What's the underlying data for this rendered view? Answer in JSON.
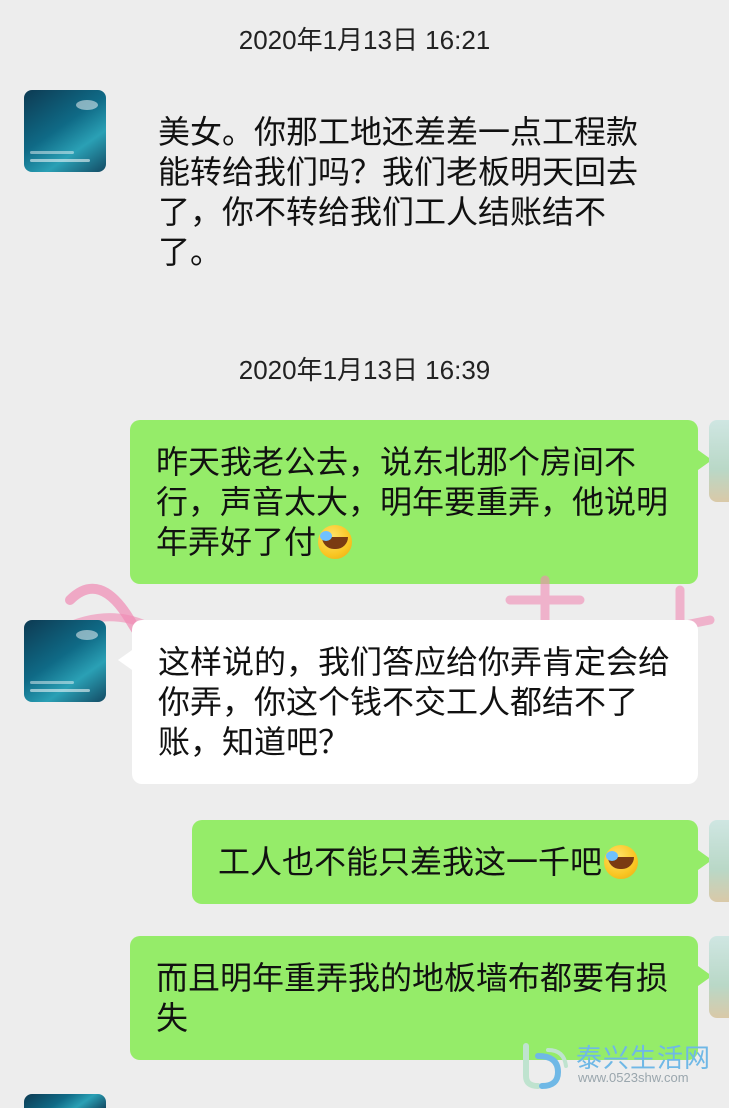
{
  "chat": {
    "timestamps": [
      "2020年1月13日 16:21",
      "2020年1月13日 16:39"
    ],
    "messages": [
      {
        "side": "left",
        "text": "美女。你那工地还差差一点工程款能转给我们吗？我们老板明天回去了，你不转给我们工人结账结不了。"
      },
      {
        "side": "right",
        "text": "昨天我老公去，说东北那个房间不行，声音太大，明年要重弄，他说明年弄好了付",
        "emoji": "face-with-tears-emoji"
      },
      {
        "side": "left",
        "text": "这样说的，我们答应给你弄肯定会给你弄，你这个钱不交工人都结不了账，知道吧？"
      },
      {
        "side": "right",
        "text": "工人也不能只差我这一千吧",
        "emoji": "face-with-tears-emoji"
      },
      {
        "side": "right",
        "text": "而且明年重弄我的地板墙布都要有损失"
      }
    ]
  },
  "watermark": {
    "site_name": "泰兴生活网",
    "site_url": "www.0523shw.com"
  },
  "colors": {
    "background": "#ededed",
    "outgoing_bubble": "#95ec69",
    "incoming_bubble": "#ffffff",
    "brand": "#6fb8e6"
  }
}
